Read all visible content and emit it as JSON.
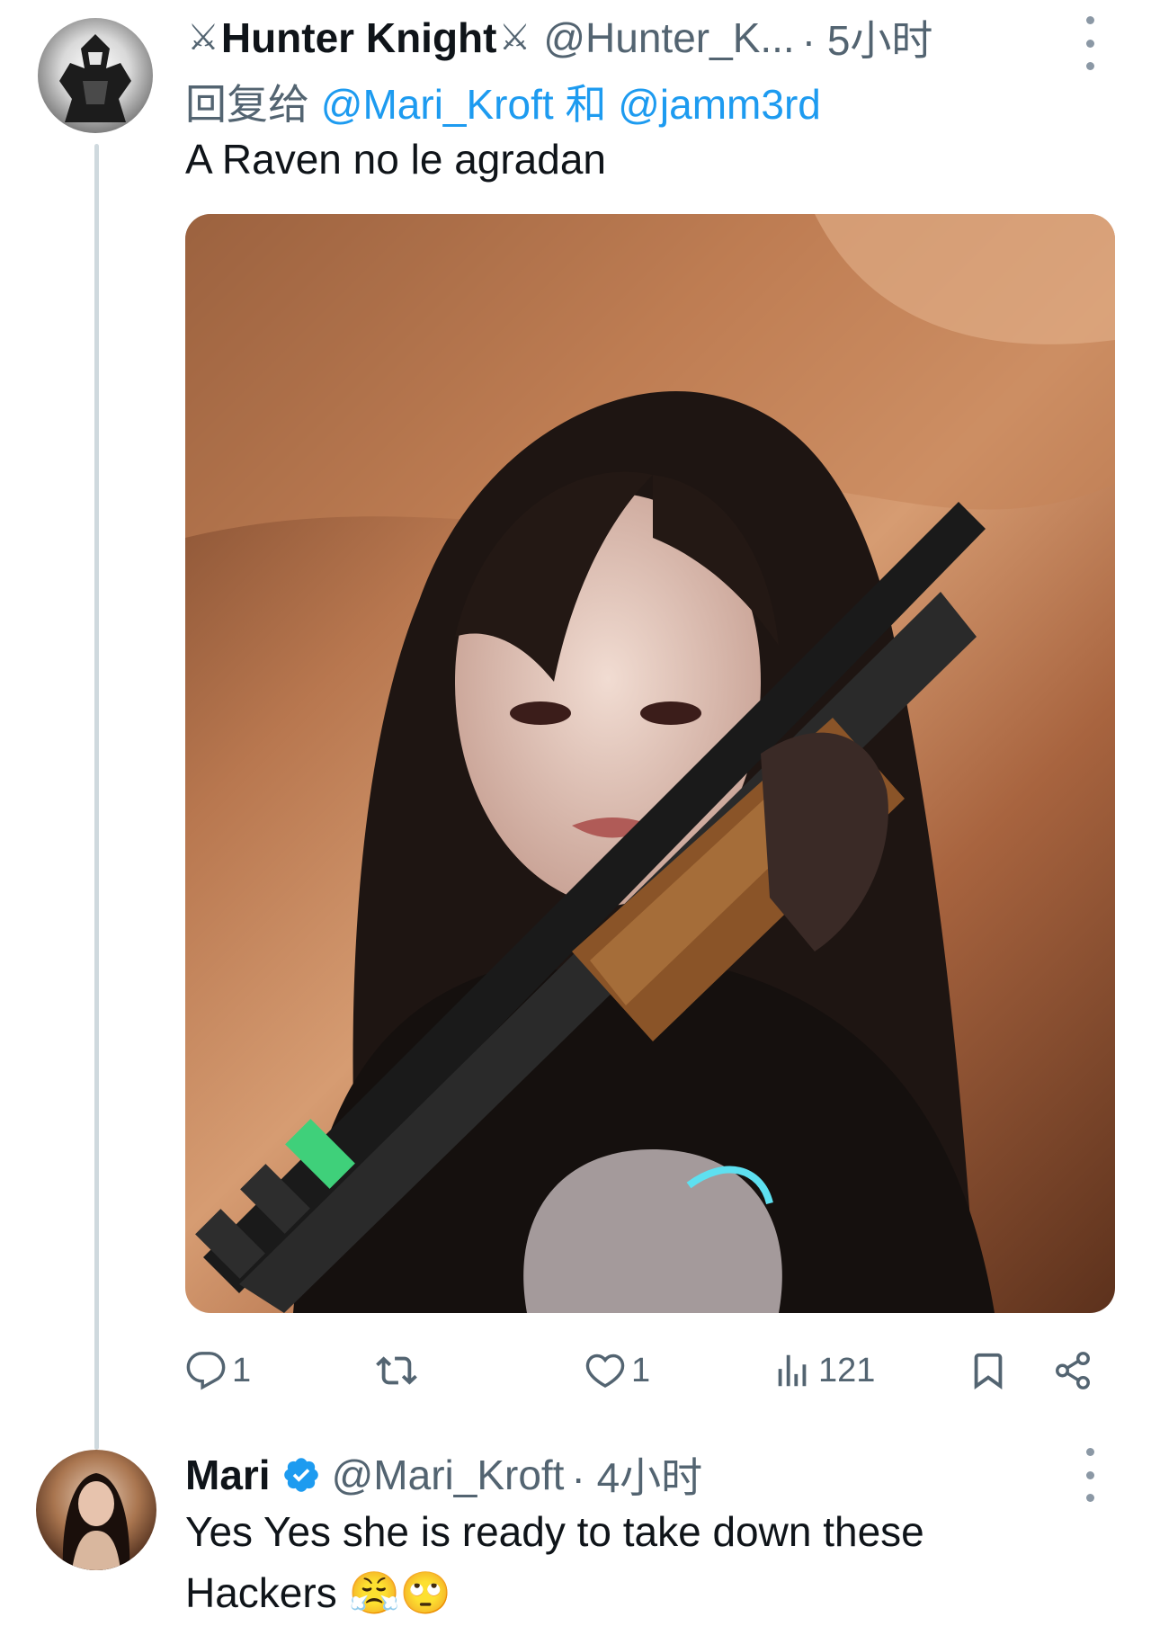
{
  "tweet1": {
    "display_name": "Hunter Knight",
    "handle": "@Hunter_K...",
    "time": "· 5小时",
    "reply_prefix": "回复给",
    "reply_mention_1": "@Mari_Kroft",
    "reply_and": "和",
    "reply_mention_2": "@jamm3rd",
    "text": "A Raven no le agradan",
    "actions": {
      "reply_count": "1",
      "retweet_count": "",
      "like_count": "1",
      "views_count": "121"
    }
  },
  "tweet2": {
    "display_name": "Mari",
    "handle": "@Mari_Kroft",
    "time": "· 4小时",
    "text_line1": "Yes Yes she is ready to take down these",
    "text_line2": "Hackers",
    "emojis": [
      "😤",
      "🙄"
    ]
  },
  "colors": {
    "link_blue": "#1d9bf0",
    "secondary_text": "#536471",
    "primary_text": "#0f1419",
    "thread_line": "#cfd9de"
  },
  "icons": {
    "reply": "reply-icon",
    "retweet": "retweet-icon",
    "like": "heart-icon",
    "views": "views-chart-icon",
    "bookmark": "bookmark-icon",
    "share": "share-icon",
    "more": "more-vertical-icon",
    "verified": "verified-badge-icon",
    "swords": "crossed-swords-icon"
  }
}
